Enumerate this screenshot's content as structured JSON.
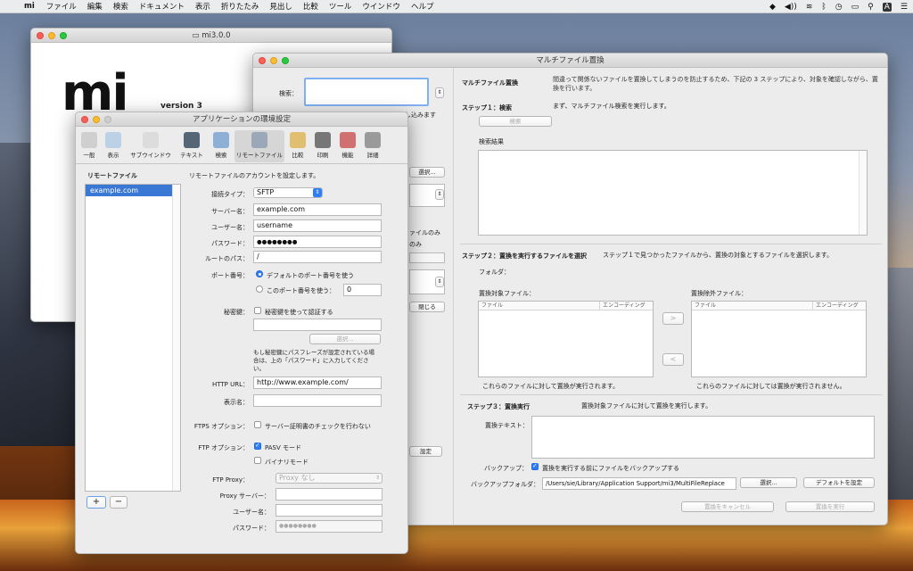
{
  "menubar": {
    "app": "mi",
    "items": [
      "ファイル",
      "編集",
      "検索",
      "ドキュメント",
      "表示",
      "折りたたみ",
      "見出し",
      "比較",
      "ツール",
      "ウインドウ",
      "ヘルプ"
    ]
  },
  "mi_window": {
    "title": "mi3.0.0",
    "logo": "mi",
    "version": "version 3"
  },
  "multi": {
    "title": "マルチファイル置換",
    "search_label": "検索：",
    "partial_1": "し込みます",
    "partial_2": "選択...",
    "partial_3": "ァイルのみ",
    "partial_4": "のみ",
    "partial_5": "閉じる",
    "partial_6": "設定",
    "header_title": "マルチファイル置換",
    "header_desc": "間違って関係ないファイルを置換してしまうのを防止するため、下記の 3 ステップにより、対象を確認しながら、置換を行います。",
    "step1_title": "ステップ１：検索",
    "step1_desc": "まず、マルチファイル検索を実行します。",
    "search_button": "検索",
    "results_label": "検索結果",
    "step2_title": "ステップ２：置換を実行するファイルを選択",
    "step2_desc": "ステップ１で見つかったファイルから、置換の対象とするファイルを選択します。",
    "folder_label": "フォルダ：",
    "target_label": "置換対象ファイル：",
    "exclude_label": "置換除外ファイル：",
    "col_file": "ファイル",
    "col_encoding": "エンコーディング",
    "target_note": "これらのファイルに対して置換が実行されます。",
    "exclude_note": "これらのファイルに対しては置換が実行されません。",
    "move_right": ">",
    "move_left": "<",
    "step3_title": "ステップ３：置換実行",
    "step3_desc": "置換対象ファイルに対して置換を実行します。",
    "replace_text_label": "置換テキスト：",
    "backup_label": "バックアップ：",
    "backup_check": "置換を実行する前にファイルをバックアップする",
    "backup_folder_label": "バックアップフォルダ：",
    "backup_folder_path": "/Users/sie/Library/Application Support/mi3/MultiFileReplace",
    "select_button": "選択...",
    "default_button": "デフォルトを設定",
    "cancel_button": "置換をキャンセル",
    "execute_button": "置換を実行"
  },
  "prefs": {
    "title": "アプリケーションの環境設定",
    "toolbar": [
      {
        "label": "一般",
        "icon": "switch-icon",
        "color": "#cfcfcf"
      },
      {
        "label": "表示",
        "icon": "display-icon",
        "color": "#bcd0e6"
      },
      {
        "label": "サブウインドウ",
        "icon": "subwindow-icon",
        "color": "#dcdcdc"
      },
      {
        "label": "テキスト",
        "icon": "text-icon",
        "color": "#556677"
      },
      {
        "label": "検索",
        "icon": "magnifier-icon",
        "color": "#8fb0d6"
      },
      {
        "label": "リモートファイル",
        "icon": "remote-file-icon",
        "color": "#9aa8b8"
      },
      {
        "label": "比較",
        "icon": "compare-icon",
        "color": "#e0c070"
      },
      {
        "label": "印刷",
        "icon": "printer-icon",
        "color": "#777777"
      },
      {
        "label": "機能",
        "icon": "palette-icon",
        "color": "#d07070"
      },
      {
        "label": "詳細",
        "icon": "gear-icon",
        "color": "#9a9a9a"
      }
    ],
    "sidebar_title": "リモートファイル",
    "account": "example.com",
    "description": "リモートファイルのアカウントを設定します。",
    "conn_type_label": "接続タイプ：",
    "conn_type": "SFTP",
    "server_label": "サーバー名：",
    "server": "example.com",
    "user_label": "ユーザー名：",
    "user": "username",
    "password_label": "パスワード：",
    "password": "●●●●●●●●",
    "root_label": "ルートのパス：",
    "root": "/",
    "port_label": "ポート番号：",
    "port_default": "デフォルトのポート番号を使う",
    "port_custom": "このポート番号を使う：",
    "port_value": "0",
    "key_label": "秘密鍵：",
    "key_check": "秘密鍵を使って認証する",
    "key_select": "選択...",
    "key_note": "もし秘密鍵にパスフレーズが設定されている場合は、上の「パスワード」に入力してください。",
    "http_label": "HTTP URL：",
    "http": "http://www.example.com/",
    "display_label": "表示名：",
    "ftps_label": "FTPS オプション：",
    "ftps_check": "サーバー証明書のチェックを行わない",
    "ftp_label": "FTP オプション：",
    "pasv": "PASV モード",
    "binary": "バイナリモード",
    "proxy_label": "FTP Proxy：",
    "proxy": "Proxy なし",
    "proxy_server_label": "Proxy サーバー：",
    "proxy_user_label": "ユーザー名：",
    "proxy_pass_label": "パスワード：",
    "proxy_pass": "●●●●●●●●",
    "add": "+",
    "remove": "−"
  }
}
